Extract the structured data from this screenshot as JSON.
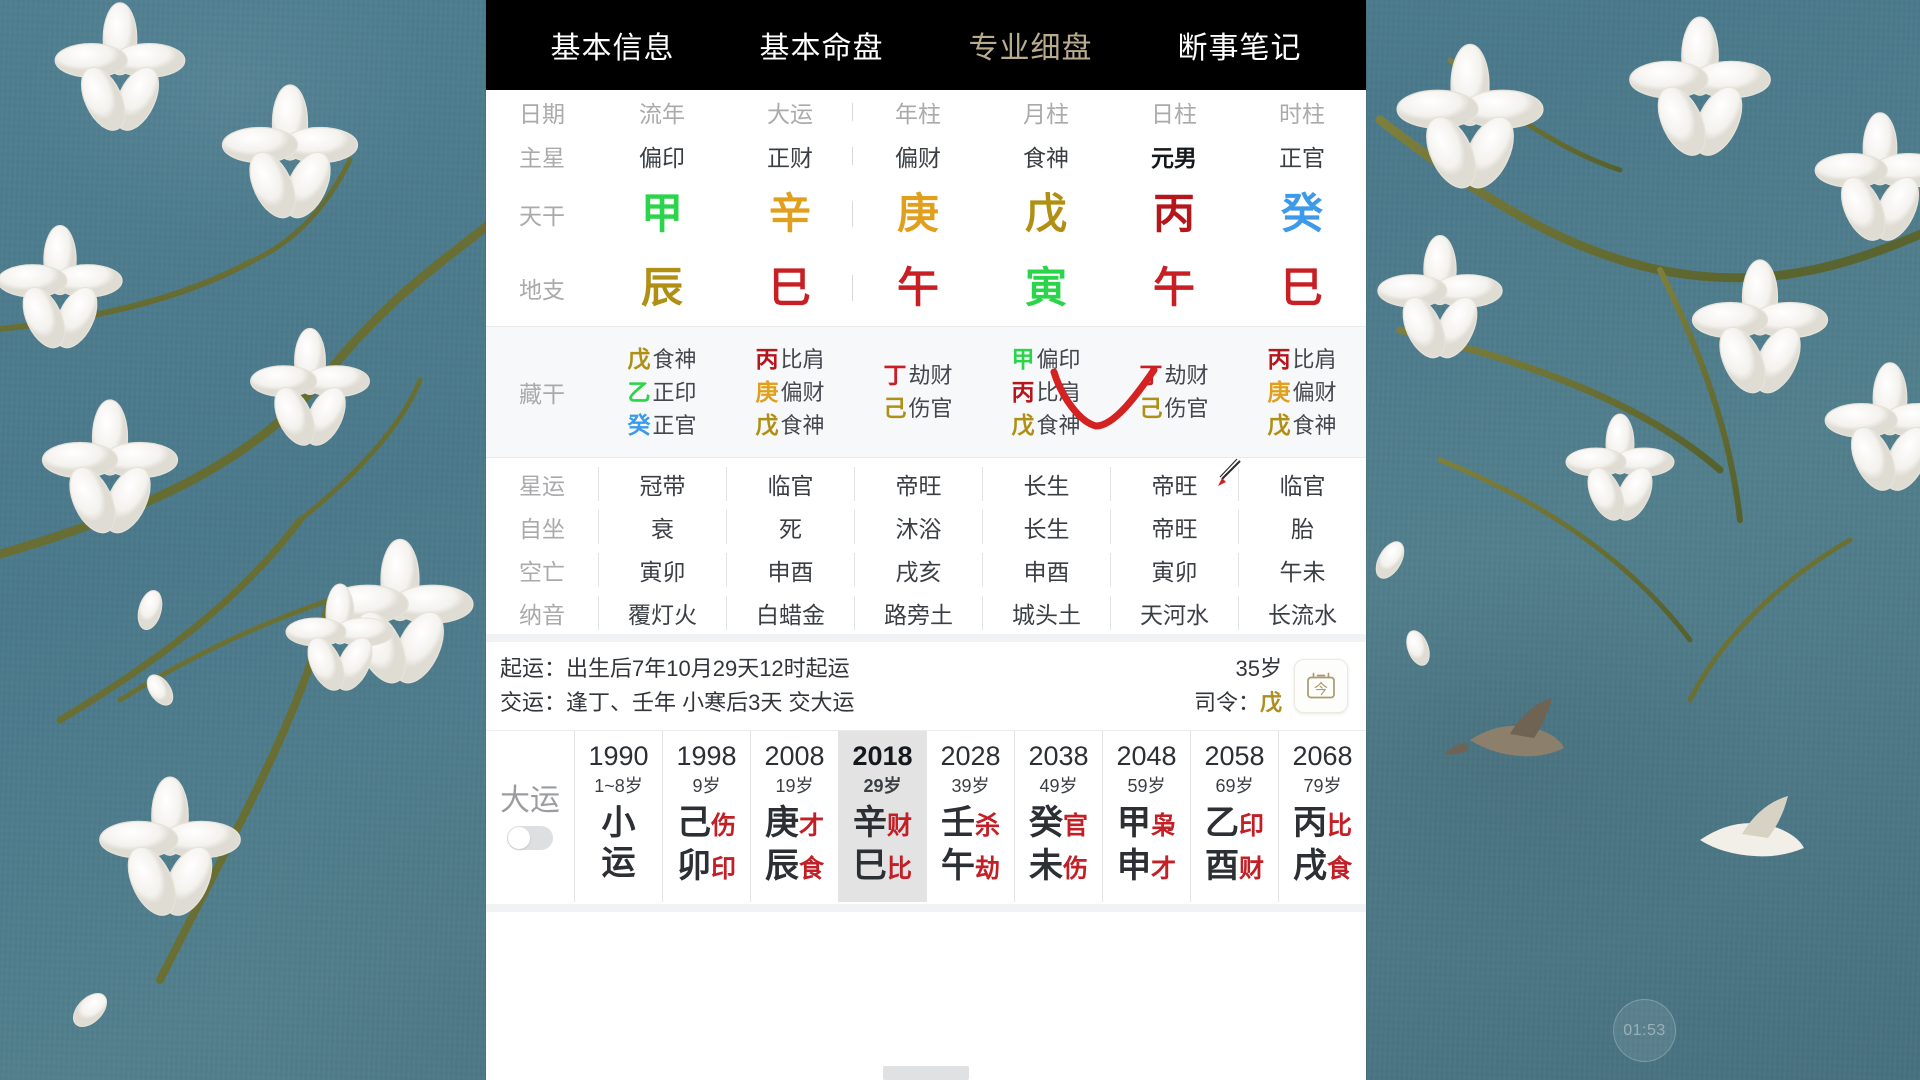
{
  "desktop": {
    "wallpaper_name": "magnolia-blossoms-teal",
    "accent_teal": "#4d7b8c",
    "timer_label": "01:53"
  },
  "app": {
    "tabs": [
      {
        "label": "基本信息",
        "state": "active"
      },
      {
        "label": "基本命盘",
        "state": "active"
      },
      {
        "label": "专业细盘",
        "state": "muted"
      },
      {
        "label": "断事笔记",
        "state": "active"
      }
    ]
  },
  "chart": {
    "columns_header": [
      "日期",
      "流年",
      "大运",
      "年柱",
      "月柱",
      "日柱",
      "时柱"
    ],
    "row_labels": {
      "main_star": "主星",
      "heavenly_stem": "天干",
      "earthly_branch": "地支",
      "hidden_stems": "藏干",
      "star_luck": "星运",
      "self_sit": "自坐",
      "void": "空亡",
      "nayin": "纳音"
    },
    "main_star": [
      "偏印",
      "正财",
      "偏财",
      "食神",
      "元男",
      "正官"
    ],
    "main_star_bold_index": 4,
    "heavenly_stem": [
      {
        "char": "甲",
        "color": "#2bd44a"
      },
      {
        "char": "辛",
        "color": "#e0a01e"
      },
      {
        "char": "庚",
        "color": "#e0a01e"
      },
      {
        "char": "戊",
        "color": "#b09014"
      },
      {
        "char": "丙",
        "color": "#b5161c"
      },
      {
        "char": "癸",
        "color": "#3d9ae8"
      }
    ],
    "earthly_branch": [
      {
        "char": "辰",
        "color": "#b09014"
      },
      {
        "char": "巳",
        "color": "#c81f25"
      },
      {
        "char": "午",
        "color": "#c81f25"
      },
      {
        "char": "寅",
        "color": "#2bd44a"
      },
      {
        "char": "午",
        "color": "#c81f25"
      },
      {
        "char": "巳",
        "color": "#c81f25"
      }
    ],
    "hidden_stems": [
      [
        {
          "g": "戊",
          "c": "#b09014",
          "r": "食神"
        },
        {
          "g": "乙",
          "c": "#2bd44a",
          "r": "正印"
        },
        {
          "g": "癸",
          "c": "#3d9ae8",
          "r": "正官"
        }
      ],
      [
        {
          "g": "丙",
          "c": "#b5161c",
          "r": "比肩"
        },
        {
          "g": "庚",
          "c": "#e0a01e",
          "r": "偏财"
        },
        {
          "g": "戊",
          "c": "#b09014",
          "r": "食神"
        }
      ],
      [
        {
          "g": "丁",
          "c": "#c81f25",
          "r": "劫财"
        },
        {
          "g": "己",
          "c": "#b09014",
          "r": "伤官"
        }
      ],
      [
        {
          "g": "甲",
          "c": "#2bd44a",
          "r": "偏印"
        },
        {
          "g": "丙",
          "c": "#b5161c",
          "r": "比肩"
        },
        {
          "g": "戊",
          "c": "#b09014",
          "r": "食神"
        }
      ],
      [
        {
          "g": "丁",
          "c": "#c81f25",
          "r": "劫财"
        },
        {
          "g": "己",
          "c": "#b09014",
          "r": "伤官"
        }
      ],
      [
        {
          "g": "丙",
          "c": "#b5161c",
          "r": "比肩"
        },
        {
          "g": "庚",
          "c": "#e0a01e",
          "r": "偏财"
        },
        {
          "g": "戊",
          "c": "#b09014",
          "r": "食神"
        }
      ]
    ],
    "star_luck": [
      "冠带",
      "临官",
      "帝旺",
      "长生",
      "帝旺",
      "临官"
    ],
    "self_sit": [
      "衰",
      "死",
      "沐浴",
      "长生",
      "帝旺",
      "胎"
    ],
    "void": [
      "寅卯",
      "申酉",
      "戌亥",
      "申酉",
      "寅卯",
      "午未"
    ],
    "nayin": [
      "覆灯火",
      "白蜡金",
      "路旁土",
      "城头土",
      "天河水",
      "长流水"
    ]
  },
  "luck_info": {
    "qiyun_label": "起运：",
    "qiyun_value": "出生后7年10月29天12时起运",
    "jiaoyun_label": "交运：",
    "jiaoyun_value": "逢丁、壬年 小寒后3天 交大运",
    "age_value": "35岁",
    "siling_label": "司令：",
    "siling_value": "戊",
    "today_icon_glyph": "今"
  },
  "dayun": {
    "label": "大运",
    "toggle_state": "off",
    "columns": [
      {
        "year": "1990",
        "age": "1~8岁",
        "top_main": "小",
        "top_sub": "",
        "bot_main": "运",
        "bot_sub": "",
        "selected": false
      },
      {
        "year": "1998",
        "age": "9岁",
        "top_main": "己",
        "top_sub": "伤",
        "bot_main": "卯",
        "bot_sub": "印",
        "selected": false
      },
      {
        "year": "2008",
        "age": "19岁",
        "top_main": "庚",
        "top_sub": "才",
        "bot_main": "辰",
        "bot_sub": "食",
        "selected": false
      },
      {
        "year": "2018",
        "age": "29岁",
        "top_main": "辛",
        "top_sub": "财",
        "bot_main": "巳",
        "bot_sub": "比",
        "selected": true
      },
      {
        "year": "2028",
        "age": "39岁",
        "top_main": "壬",
        "top_sub": "杀",
        "bot_main": "午",
        "bot_sub": "劫",
        "selected": false
      },
      {
        "year": "2038",
        "age": "49岁",
        "top_main": "癸",
        "top_sub": "官",
        "bot_main": "未",
        "bot_sub": "伤",
        "selected": false
      },
      {
        "year": "2048",
        "age": "59岁",
        "top_main": "甲",
        "top_sub": "枭",
        "bot_main": "申",
        "bot_sub": "才",
        "selected": false
      },
      {
        "year": "2058",
        "age": "69岁",
        "top_main": "乙",
        "top_sub": "印",
        "bot_main": "酉",
        "bot_sub": "财",
        "selected": false
      },
      {
        "year": "2068",
        "age": "79岁",
        "top_main": "丙",
        "top_sub": "比",
        "bot_main": "戌",
        "bot_sub": "食",
        "selected": false
      }
    ]
  },
  "annotations": {
    "check_mark_color": "#d42222",
    "cursor_color": "#cc2222"
  }
}
